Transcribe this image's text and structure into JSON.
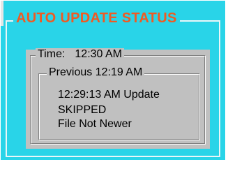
{
  "status_panel": {
    "title": "AUTO UPDATE STATUS",
    "colors": {
      "background": "#29d4e8",
      "title": "#f05a22",
      "box": "#c0c0c0"
    }
  },
  "time_box": {
    "time_label": "Time:",
    "time_value": "12:30 AM",
    "previous_label": "Previous",
    "previous_value": "12:19 AM",
    "details": [
      "12:29:13 AM Update",
      "SKIPPED",
      "File Not Newer"
    ]
  }
}
